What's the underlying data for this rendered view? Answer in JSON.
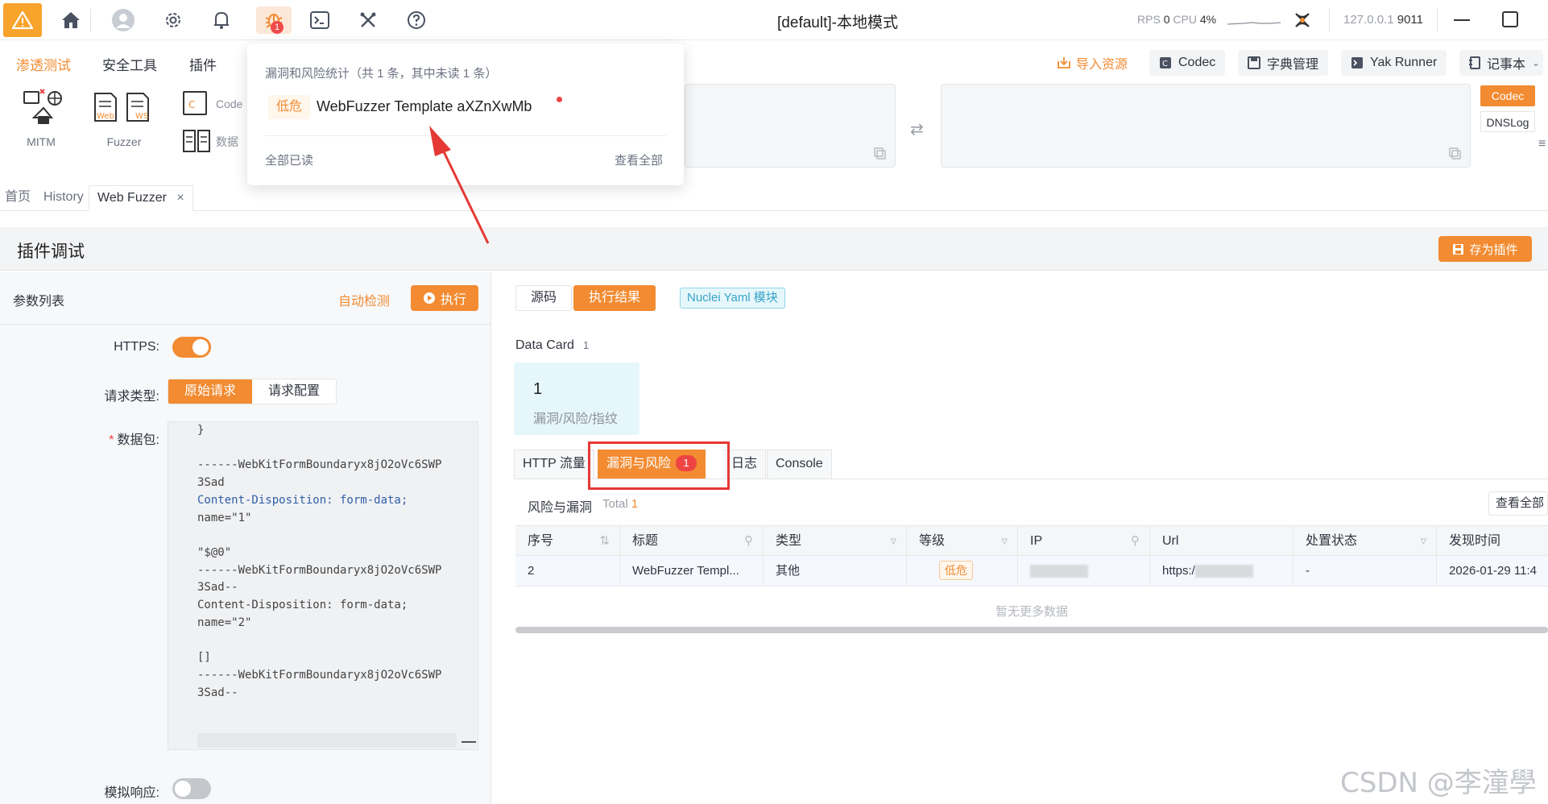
{
  "titlebar": {
    "title": "[default]-本地模式",
    "bug_badge": "1",
    "rps_label": "RPS",
    "rps_value": "0",
    "cpu_label": "CPU",
    "cpu_value": "4%",
    "host_ip": "127.0.0.1",
    "host_port": "9011"
  },
  "menu": {
    "items": [
      "渗透测试",
      "安全工具",
      "插件"
    ],
    "import_label": "导入资源",
    "codec_label": "Codec",
    "dict_label": "字典管理",
    "yak_label": "Yak Runner",
    "notes_label": "记事本"
  },
  "tools": {
    "mitm": "MITM",
    "fuzzer": "Fuzzer",
    "web_tag": "Web",
    "ws_tag": "WS",
    "codec_small": "Code",
    "data_small": "数据"
  },
  "side_tags": {
    "codec": "Codec",
    "dnslog": "DNSLog"
  },
  "tabs": {
    "home": "首页",
    "history": "History",
    "fuzzer": "Web Fuzzer"
  },
  "plugin": {
    "title": "插件调试",
    "save_label": "存为插件",
    "params_title": "参数列表",
    "auto_detect": "自动检测",
    "exec_label": "执行",
    "https_label": "HTTPS",
    "req_type_label": "请求类型",
    "req_raw": "原始请求",
    "req_config": "请求配置",
    "packet_label": "数据包",
    "mock_label": "模拟响应",
    "code_lines": [
      "}",
      "",
      "------WebKitFormBoundaryx8jO2oVc6SWP",
      "3Sad",
      "Content-Disposition: form-data; ",
      "name=\"1\"",
      "",
      "\"$@0\"",
      "------WebKitFormBoundaryx8jO2oVc6SWP",
      "3Sad--",
      "Content-Disposition: form-data; ",
      "name=\"2\"",
      "",
      "[]",
      "------WebKitFormBoundaryx8jO2oVc6SWP",
      "3Sad--"
    ]
  },
  "result": {
    "source_btn": "源码",
    "result_btn": "执行结果",
    "nuclei_tag": "Nuclei Yaml 模块",
    "datacard_label": "Data Card",
    "datacard_count": "1",
    "card_value": "1",
    "card_label": "漏洞/风险/指纹",
    "subtabs": [
      "HTTP 流量",
      "漏洞与风险",
      "日志",
      "Console"
    ],
    "vuln_badge": "1",
    "risk_title": "风险与漏洞",
    "total_label": "Total",
    "total_value": "1",
    "view_all": "查看全部",
    "columns": [
      "序号",
      "标题",
      "类型",
      "等级",
      "IP",
      "Url",
      "处置状态",
      "发现时间"
    ],
    "rows": [
      {
        "id": "2",
        "title": "WebFuzzer Templ...",
        "type": "其他",
        "level": "低危",
        "ip": "",
        "url": "https:/",
        "status": "-",
        "time": "2026-01-29 11:4"
      }
    ],
    "no_more": "暂无更多数据"
  },
  "popover": {
    "title": "漏洞和风险统计（共 1 条，其中未读 1 条）",
    "level": "低危",
    "name": "WebFuzzer Template aXZnXwMb",
    "read_all": "全部已读",
    "view_all": "查看全部"
  },
  "watermark": "CSDN @李潼學",
  "colors": {
    "accent": "#f28b31",
    "danger": "#e53935",
    "info": "#36a3c9"
  }
}
